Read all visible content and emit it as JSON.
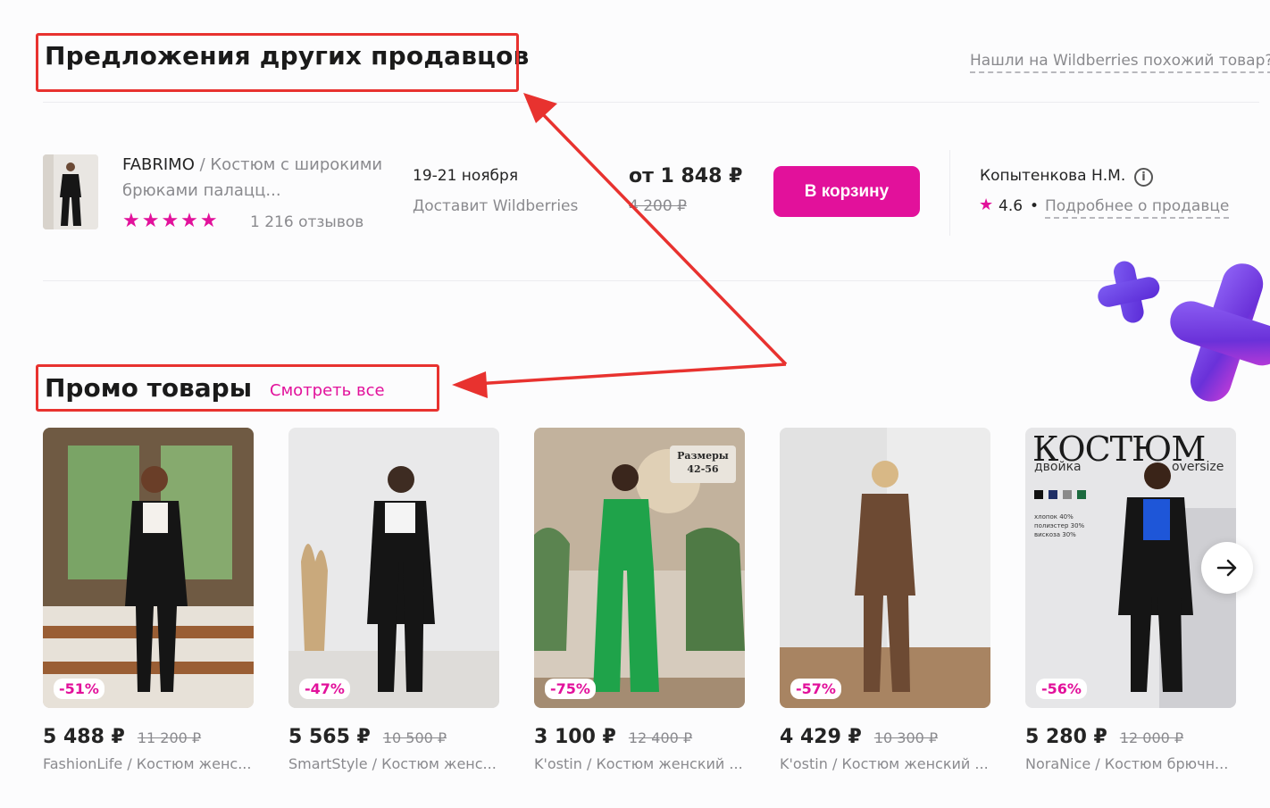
{
  "other_sellers": {
    "title": "Предложения других продавцов",
    "similar_link": "Нашли на Wildberries похожий товар?",
    "offer": {
      "brand": "FABRIMO",
      "separator": " / ",
      "name": "Костюм с широкими брюками палацц...",
      "stars": "★★★★★",
      "reviews": "1 216 отзывов",
      "delivery_date": "19-21 ноября",
      "delivery_by": "Доставит Wildberries",
      "price": "от 1 848 ₽",
      "old_price": "4 200 ₽",
      "cart_button": "В корзину",
      "seller_name": "Копытенкова Н.М.",
      "info_icon": "i",
      "rating_star": "★",
      "rating": "4.6",
      "rating_dot": "•",
      "seller_more": "Подробнее о продавце"
    }
  },
  "promo": {
    "title": "Промо товары",
    "see_all": "Смотреть все",
    "items": [
      {
        "discount": "-51%",
        "price": "5 488 ₽",
        "old_price": "11 200 ₽",
        "desc": "FashionLife / Костюм женс..."
      },
      {
        "discount": "-47%",
        "price": "5 565 ₽",
        "old_price": "10 500 ₽",
        "desc": "SmartStyle / Костюм женс..."
      },
      {
        "discount": "-75%",
        "price": "3 100 ₽",
        "old_price": "12 400 ₽",
        "desc": "K'ostin / Костюм женский ...",
        "badge": "Размеры 42-56"
      },
      {
        "discount": "-57%",
        "price": "4 429 ₽",
        "old_price": "10 300 ₽",
        "desc": "K'ostin / Костюм женский ..."
      },
      {
        "discount": "-56%",
        "price": "5 280 ₽",
        "old_price": "12 000 ₽",
        "desc": "NoraNice / Костюм брючн...",
        "headline": "КОСТЮМ",
        "sub_left": "двойка",
        "sub_right": "oversize",
        "composition": [
          "хлопок 40%",
          "полиэстер 30%",
          "вискоза 30%"
        ]
      }
    ]
  },
  "colors": {
    "accent": "#e2119b",
    "annotation_red": "#e8322f"
  }
}
